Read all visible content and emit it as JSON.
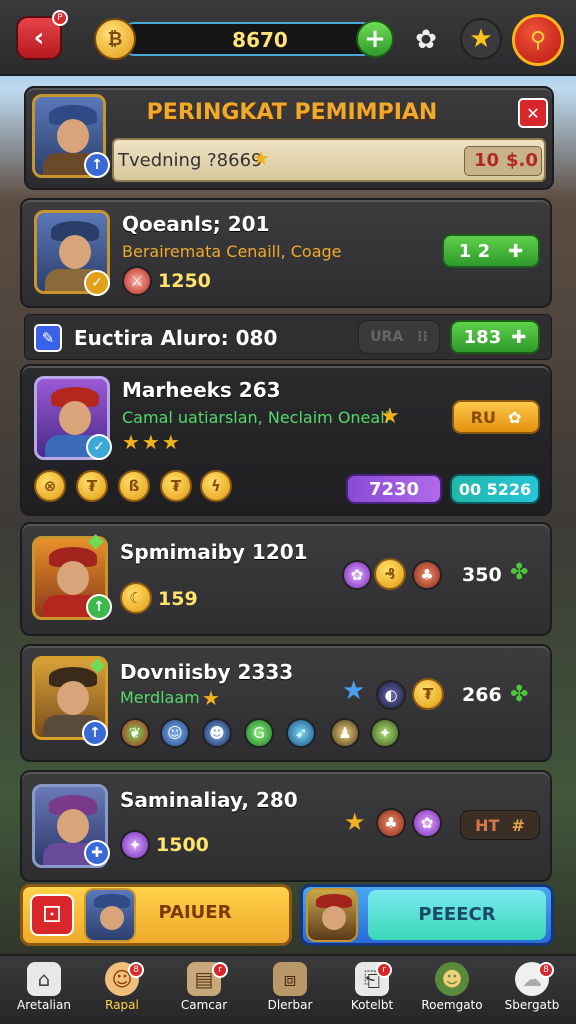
{
  "topbar": {
    "coins": "8670"
  },
  "header": {
    "title": "PERINGKAT PEMIMPIAN",
    "subtitle": "Tvedning ?8669",
    "close": "✕",
    "score_a": "10",
    "score_b": "$.0"
  },
  "players": [
    {
      "name": "Qoeanls; 201",
      "subtitle": "Berairemata Cenaill, Coage",
      "score": "1250",
      "button": "1 2"
    },
    {
      "name": "Marheeks 263",
      "subtitle": "Camal uatiarslan, Neclaim Oneali",
      "pill_left": "7230",
      "pill_right": "00 5226",
      "button": "RU"
    },
    {
      "name": "Spmimaiby 1201",
      "score": "159",
      "points": "350"
    },
    {
      "name": "Dovniisby 2333",
      "subtitle": "Merdlaam",
      "points": "266"
    },
    {
      "name": "Saminaliay, 280",
      "score": "1500",
      "button": "HT"
    }
  ],
  "extra": {
    "label": "Euctira Aluro: 080",
    "tag": "URA",
    "button": "183"
  },
  "actions": {
    "left": "PAIUER",
    "right": "PEEECR"
  },
  "nav": [
    "Aretalian",
    "Rapal",
    "Camcar",
    "Dlerbar",
    "Kotelbt",
    "Roemgato",
    "Sbergatb"
  ],
  "colors": {
    "gold": "#f0a92a",
    "green": "#3db84a",
    "cyan": "#27c4d8",
    "purple": "#8a4ad6",
    "red": "#d9262b"
  }
}
